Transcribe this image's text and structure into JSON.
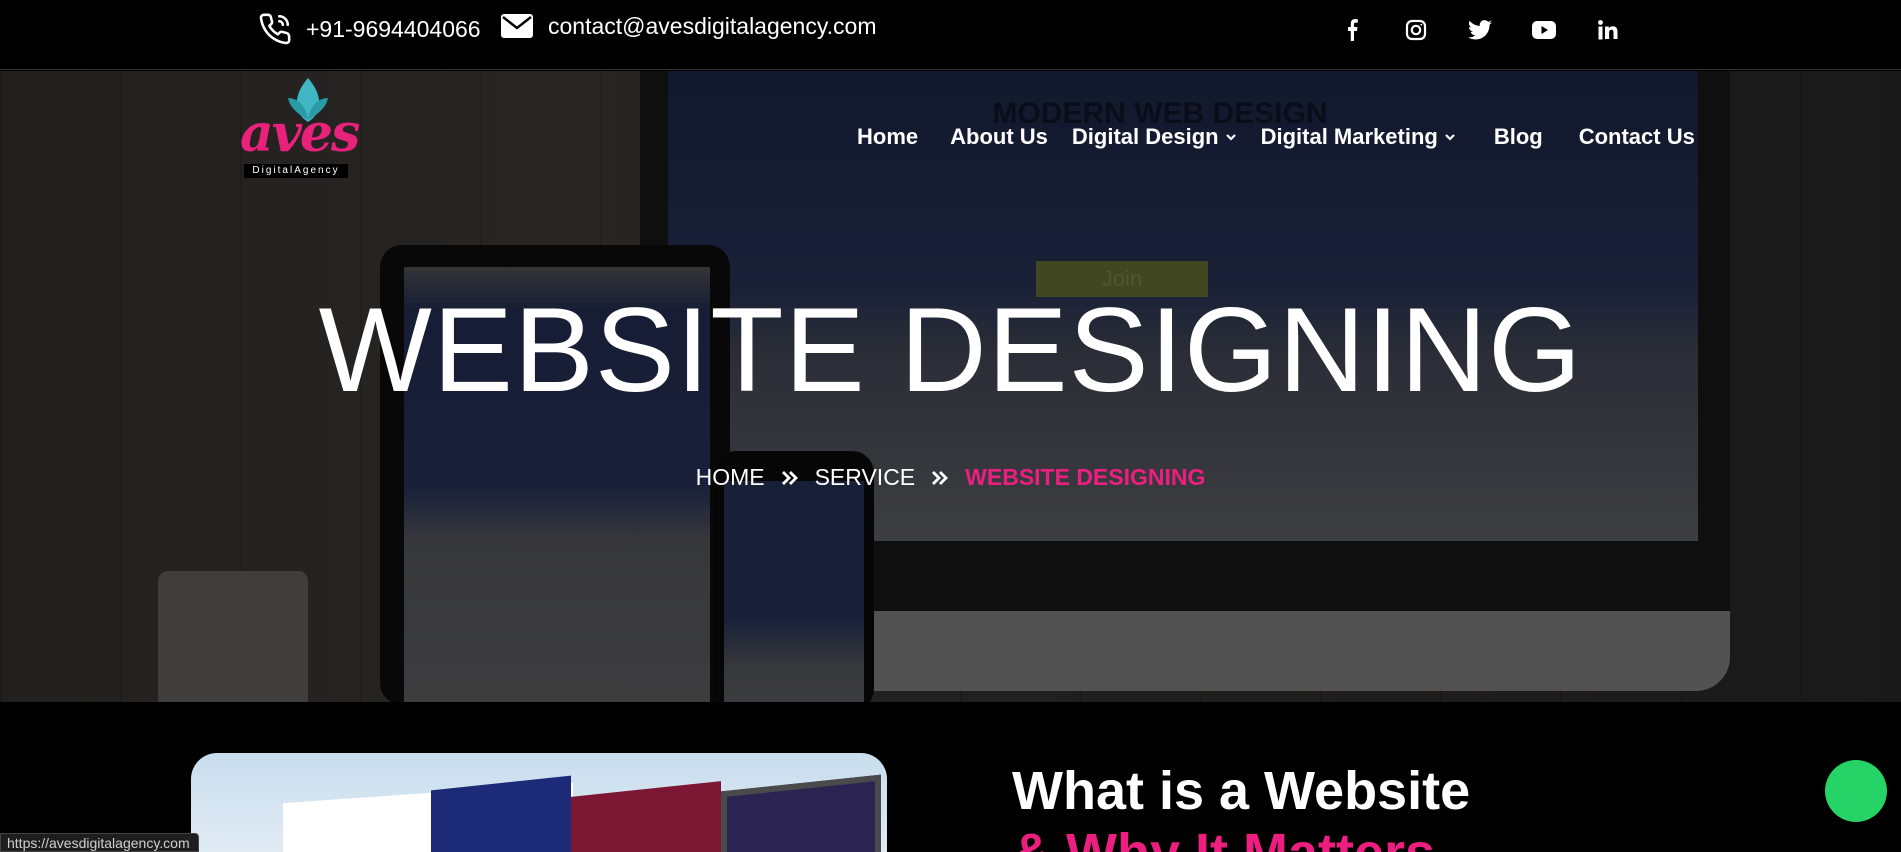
{
  "topbar": {
    "phone": "+91-9694404066",
    "email": "contact@avesdigitalagency.com",
    "phone_icon": "phone-icon",
    "email_icon": "envelope-icon",
    "social": [
      "facebook-icon",
      "instagram-icon",
      "twitter-icon",
      "youtube-icon",
      "linkedin-icon"
    ]
  },
  "logo": {
    "word": "aves",
    "subtitle": "DigitalAgency"
  },
  "hero": {
    "screen_text": "MODERN WEB DESIGN",
    "join_text": "Join"
  },
  "nav": {
    "items": [
      {
        "label": "Home",
        "has_dropdown": false
      },
      {
        "label": "About Us",
        "has_dropdown": false
      },
      {
        "label": "Digital Design",
        "has_dropdown": true
      },
      {
        "label": "Digital Marketing",
        "has_dropdown": true
      },
      {
        "label": "Blog",
        "has_dropdown": false
      },
      {
        "label": "Contact Us",
        "has_dropdown": false
      }
    ]
  },
  "page": {
    "title": "WEBSITE DESIGNING",
    "breadcrumb": [
      "HOME",
      "SERVICE",
      "WEBSITE DESIGNING"
    ]
  },
  "section": {
    "title_line1": "What is a Website",
    "title_line2": "& Why It Matters"
  },
  "status_bar": {
    "url": "https://avesdigitalagency.com"
  },
  "colors": {
    "accent": "#ec1f80",
    "background": "#000000",
    "whatsapp": "#25d366"
  }
}
